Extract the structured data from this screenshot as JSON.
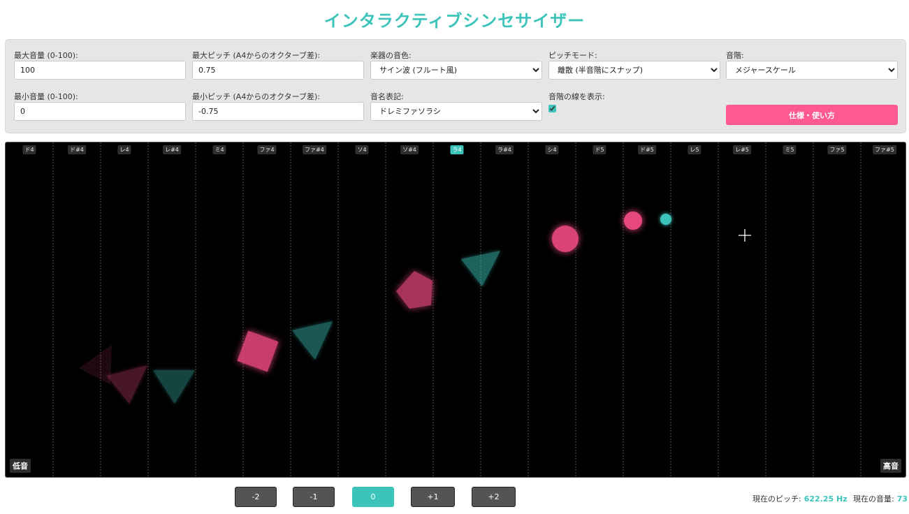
{
  "title": "インタラクティブシンセサイザー",
  "controls": {
    "max_volume": {
      "label": "最大音量 (0-100):",
      "value": "100"
    },
    "max_pitch": {
      "label": "最大ピッチ (A4からのオクターブ差):",
      "value": "0.75"
    },
    "instrument": {
      "label": "楽器の音色:",
      "value": "サイン波 (フルート風)"
    },
    "pitch_mode": {
      "label": "ピッチモード:",
      "value": "離散 (半音階にスナップ)"
    },
    "scale": {
      "label": "音階:",
      "value": "メジャースケール"
    },
    "min_volume": {
      "label": "最小音量 (0-100):",
      "value": "0"
    },
    "min_pitch": {
      "label": "最小ピッチ (A4からのオクターブ差):",
      "value": "-0.75"
    },
    "note_notation": {
      "label": "音名表記:",
      "value": "ドレミファソラシ"
    },
    "show_lines": {
      "label": "音階の線を表示:",
      "checked": true
    },
    "spec_button": "仕様・使い方"
  },
  "stage": {
    "notes": [
      "ド4",
      "ド#4",
      "レ4",
      "レ#4",
      "ミ4",
      "ファ4",
      "ファ#4",
      "ソ4",
      "ソ#4",
      "ラ4",
      "ラ#4",
      "シ4",
      "ド5",
      "ド#5",
      "レ5",
      "レ#5",
      "ミ5",
      "ファ5",
      "ファ#5"
    ],
    "active_note": "ラ4",
    "low_label": "低音",
    "high_label": "高音",
    "colors": {
      "pink": "#ff4f8b",
      "teal": "#3dc4ba"
    }
  },
  "octave_buttons": [
    "-2",
    "-1",
    "0",
    "+1",
    "+2"
  ],
  "active_octave": "0",
  "status": {
    "pitch_label": "現在のピッチ:",
    "pitch_value": "622.25 Hz",
    "volume_label": "現在の音量:",
    "volume_value": "73"
  }
}
